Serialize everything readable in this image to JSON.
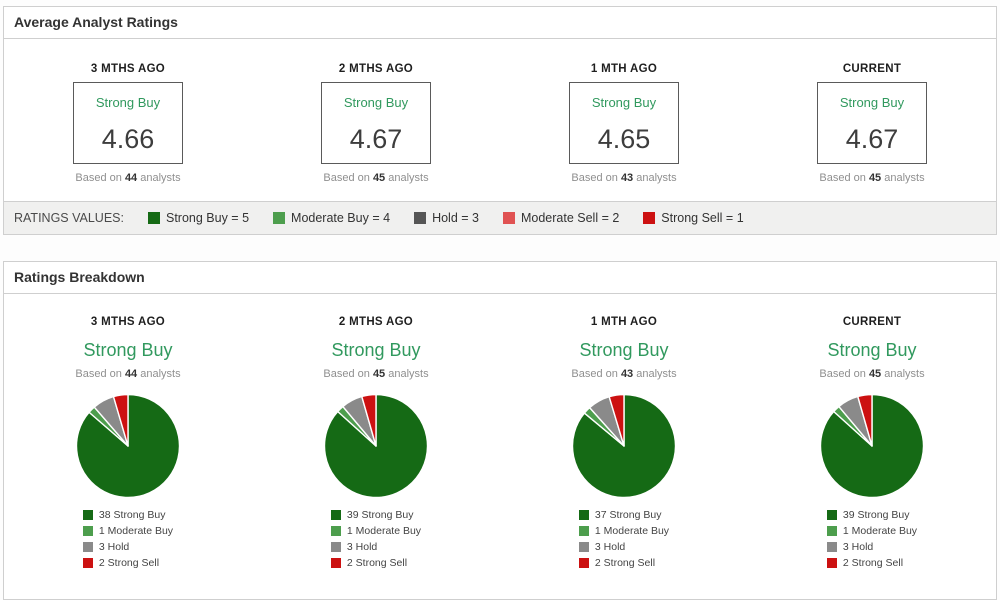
{
  "colors": {
    "strong_buy": "#156a15",
    "moderate_buy": "#4d9e4d",
    "hold": "#8a8a8a",
    "hold_dark": "#555555",
    "moderate_sell": "#e05252",
    "strong_sell": "#cc1111",
    "rating_text_green": "#31995e"
  },
  "avg_panel": {
    "title": "Average Analyst Ratings",
    "based_prefix": "Based on",
    "based_suffix": "analysts",
    "cards": [
      {
        "period": "3 MTHS AGO",
        "rating_label": "Strong Buy",
        "value": "4.66",
        "count": "44"
      },
      {
        "period": "2 MTHS AGO",
        "rating_label": "Strong Buy",
        "value": "4.67",
        "count": "45"
      },
      {
        "period": "1 MTH AGO",
        "rating_label": "Strong Buy",
        "value": "4.65",
        "count": "43"
      },
      {
        "period": "CURRENT",
        "rating_label": "Strong Buy",
        "value": "4.67",
        "count": "45"
      }
    ],
    "legend_label": "RATINGS VALUES:",
    "legend_items": [
      {
        "label": "Strong Buy = 5",
        "color": "#156a15"
      },
      {
        "label": "Moderate Buy = 4",
        "color": "#4d9e4d"
      },
      {
        "label": "Hold = 3",
        "color": "#555555"
      },
      {
        "label": "Moderate Sell = 2",
        "color": "#e05252"
      },
      {
        "label": "Strong Sell = 1",
        "color": "#cc1111"
      }
    ]
  },
  "breakdown_panel": {
    "title": "Ratings Breakdown",
    "based_prefix": "Based on",
    "based_suffix": "analysts",
    "columns": [
      {
        "period": "3 MTHS AGO",
        "rating_label": "Strong Buy",
        "count": "44",
        "slices": [
          {
            "name": "Strong Buy",
            "value": 38,
            "legend": "38 Strong Buy",
            "color": "#156a15"
          },
          {
            "name": "Moderate Buy",
            "value": 1,
            "legend": "1 Moderate Buy",
            "color": "#4d9e4d"
          },
          {
            "name": "Hold",
            "value": 3,
            "legend": "3 Hold",
            "color": "#8a8a8a"
          },
          {
            "name": "Strong Sell",
            "value": 2,
            "legend": "2 Strong Sell",
            "color": "#cc1111"
          }
        ]
      },
      {
        "period": "2 MTHS AGO",
        "rating_label": "Strong Buy",
        "count": "45",
        "slices": [
          {
            "name": "Strong Buy",
            "value": 39,
            "legend": "39 Strong Buy",
            "color": "#156a15"
          },
          {
            "name": "Moderate Buy",
            "value": 1,
            "legend": "1 Moderate Buy",
            "color": "#4d9e4d"
          },
          {
            "name": "Hold",
            "value": 3,
            "legend": "3 Hold",
            "color": "#8a8a8a"
          },
          {
            "name": "Strong Sell",
            "value": 2,
            "legend": "2 Strong Sell",
            "color": "#cc1111"
          }
        ]
      },
      {
        "period": "1 MTH AGO",
        "rating_label": "Strong Buy",
        "count": "43",
        "slices": [
          {
            "name": "Strong Buy",
            "value": 37,
            "legend": "37 Strong Buy",
            "color": "#156a15"
          },
          {
            "name": "Moderate Buy",
            "value": 1,
            "legend": "1 Moderate Buy",
            "color": "#4d9e4d"
          },
          {
            "name": "Hold",
            "value": 3,
            "legend": "3 Hold",
            "color": "#8a8a8a"
          },
          {
            "name": "Strong Sell",
            "value": 2,
            "legend": "2 Strong Sell",
            "color": "#cc1111"
          }
        ]
      },
      {
        "period": "CURRENT",
        "rating_label": "Strong Buy",
        "count": "45",
        "slices": [
          {
            "name": "Strong Buy",
            "value": 39,
            "legend": "39 Strong Buy",
            "color": "#156a15"
          },
          {
            "name": "Moderate Buy",
            "value": 1,
            "legend": "1 Moderate Buy",
            "color": "#4d9e4d"
          },
          {
            "name": "Hold",
            "value": 3,
            "legend": "3 Hold",
            "color": "#8a8a8a"
          },
          {
            "name": "Strong Sell",
            "value": 2,
            "legend": "2 Strong Sell",
            "color": "#cc1111"
          }
        ]
      }
    ]
  },
  "chart_data": [
    {
      "type": "pie",
      "title": "3 MTHS AGO",
      "subtitle": "Strong Buy",
      "total_analysts": 44,
      "average_rating": 4.66,
      "labels": [
        "Strong Buy",
        "Moderate Buy",
        "Hold",
        "Strong Sell"
      ],
      "values": [
        38,
        1,
        3,
        2
      ],
      "colors": [
        "#156a15",
        "#4d9e4d",
        "#8a8a8a",
        "#cc1111"
      ],
      "legend_position": "bottom-left",
      "start_angle": "12-oclock-clockwise"
    },
    {
      "type": "pie",
      "title": "2 MTHS AGO",
      "subtitle": "Strong Buy",
      "total_analysts": 45,
      "average_rating": 4.67,
      "labels": [
        "Strong Buy",
        "Moderate Buy",
        "Hold",
        "Strong Sell"
      ],
      "values": [
        39,
        1,
        3,
        2
      ],
      "colors": [
        "#156a15",
        "#4d9e4d",
        "#8a8a8a",
        "#cc1111"
      ],
      "legend_position": "bottom-left",
      "start_angle": "12-oclock-clockwise"
    },
    {
      "type": "pie",
      "title": "1 MTH AGO",
      "subtitle": "Strong Buy",
      "total_analysts": 43,
      "average_rating": 4.65,
      "labels": [
        "Strong Buy",
        "Moderate Buy",
        "Hold",
        "Strong Sell"
      ],
      "values": [
        37,
        1,
        3,
        2
      ],
      "colors": [
        "#156a15",
        "#4d9e4d",
        "#8a8a8a",
        "#cc1111"
      ],
      "legend_position": "bottom-left",
      "start_angle": "12-oclock-clockwise"
    },
    {
      "type": "pie",
      "title": "CURRENT",
      "subtitle": "Strong Buy",
      "total_analysts": 45,
      "average_rating": 4.67,
      "labels": [
        "Strong Buy",
        "Moderate Buy",
        "Hold",
        "Strong Sell"
      ],
      "values": [
        39,
        1,
        3,
        2
      ],
      "colors": [
        "#156a15",
        "#4d9e4d",
        "#8a8a8a",
        "#cc1111"
      ],
      "legend_position": "bottom-left",
      "start_angle": "12-oclock-clockwise"
    }
  ]
}
